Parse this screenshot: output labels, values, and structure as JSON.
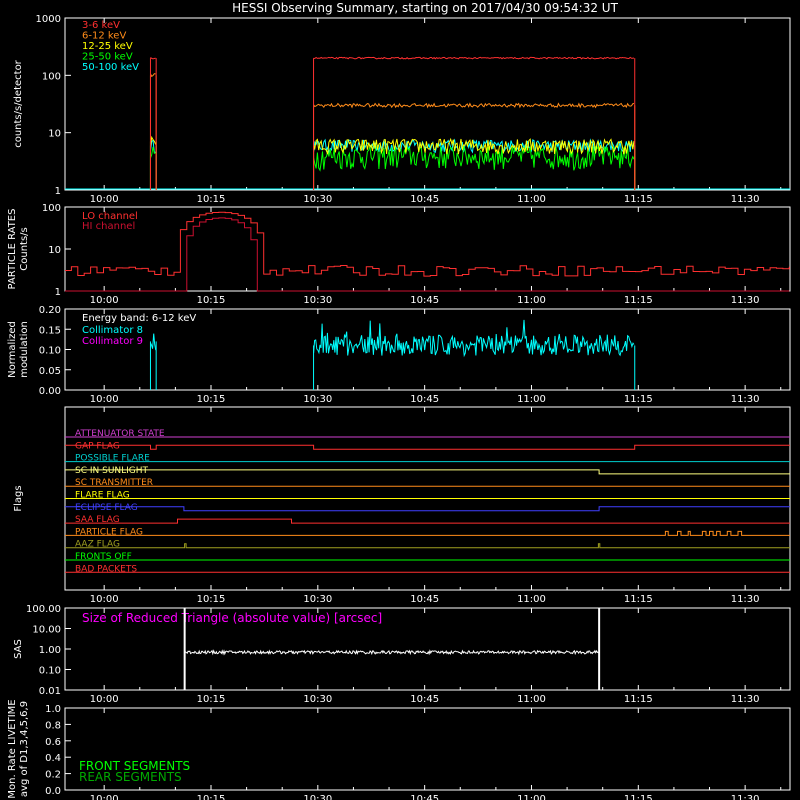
{
  "title": "HESSI Observing Summary, starting on 2017/04/30 09:54:32 UT",
  "time_axis": {
    "ticks": [
      "10:00",
      "10:15",
      "10:30",
      "10:45",
      "11:00",
      "11:15",
      "11:30"
    ],
    "tick_minutes": [
      0,
      15,
      30,
      45,
      60,
      75,
      90
    ],
    "range_minutes": [
      -5.5,
      96.3
    ]
  },
  "colors": {
    "axes": "#ffffff",
    "band_3_6": "#ff3030",
    "band_6_12": "#ff8c1a",
    "band_12_25": "#ffff00",
    "band_25_50": "#00ff00",
    "band_50_100": "#00ffff",
    "particle_lo": "#ff3030",
    "particle_hi": "#cc1030",
    "collimator_8": "#00ffff",
    "collimator_9": "#ff00ff",
    "sas": "#ffffff",
    "front_segments": "#00ff00",
    "rear_segments": "#00aa00"
  },
  "chart_data": [
    {
      "type": "line",
      "panel": "count-rates",
      "ylabel": "counts/s/detector",
      "yscale": "log",
      "ylim": [
        1,
        1000
      ],
      "yticks": [
        "1",
        "10",
        "100",
        "1000"
      ],
      "series": [
        {
          "name": "3-6 keV",
          "segments": [
            {
              "x": [
                6.5,
                7.3
              ],
              "level": 200
            },
            {
              "x": [
                29.4,
                74.5
              ],
              "level": 200
            }
          ]
        },
        {
          "name": "6-12 keV",
          "segments": [
            {
              "x": [
                6.5,
                7.3
              ],
              "level": 100
            },
            {
              "x": [
                29.4,
                74.5
              ],
              "level": 30
            }
          ]
        },
        {
          "name": "12-25 keV",
          "segments": [
            {
              "x": [
                6.5,
                7.3
              ],
              "level": 7
            },
            {
              "x": [
                29.4,
                74.5
              ],
              "level": 6
            }
          ]
        },
        {
          "name": "25-50 keV",
          "segments": [
            {
              "x": [
                6.5,
                7.3
              ],
              "level": 4
            },
            {
              "x": [
                29.4,
                74.5
              ],
              "level": 4
            }
          ]
        },
        {
          "name": "50-100 keV",
          "segments": [
            {
              "x": [
                6.5,
                7.3
              ],
              "level": 6
            },
            {
              "x": [
                29.4,
                74.5
              ],
              "level": 6
            }
          ]
        }
      ]
    },
    {
      "type": "line",
      "panel": "particle-rates",
      "ylabel": "PARTICLE RATES Counts/s",
      "yscale": "log",
      "ylim": [
        1,
        100
      ],
      "yticks": [
        "1",
        "10",
        "100"
      ],
      "series": [
        {
          "name": "LO channel",
          "background": 3,
          "peak": 75,
          "peak_start": 10,
          "peak_end": 22
        },
        {
          "name": "HI channel",
          "background": 1,
          "peak": 55,
          "peak_start": 11,
          "peak_end": 21
        }
      ]
    },
    {
      "type": "line",
      "panel": "modulation",
      "ylabel": "Normalized modulation",
      "ylim": [
        0,
        0.2
      ],
      "yticks": [
        "0.00",
        "0.05",
        "0.10",
        "0.15",
        "0.20"
      ],
      "annotation": "Energy band: 6-12 keV",
      "series": [
        {
          "name": "Collimator 8",
          "segments": [
            {
              "x": [
                6.5,
                7.3
              ],
              "level": 0.12
            },
            {
              "x": [
                29.4,
                74.5
              ],
              "level": 0.11
            }
          ]
        },
        {
          "name": "Collimator 9",
          "segments": []
        }
      ]
    },
    {
      "type": "table",
      "panel": "flags",
      "ylabel": "Flags",
      "rows": [
        {
          "label": "ATTENUATOR STATE",
          "color": "#d040d0",
          "changes": [],
          "initial": 0
        },
        {
          "label": "GAP FLAG",
          "color": "#ff3030",
          "changes": [
            6.5,
            7.3,
            29.4,
            74.5
          ],
          "initial": 1
        },
        {
          "label": "POSSIBLE FLARE",
          "color": "#00d0d0",
          "changes": [],
          "initial": 0
        },
        {
          "label": "SC IN SUNLIGHT",
          "color": "#ffff80",
          "changes": [
            69.5
          ],
          "initial": 1
        },
        {
          "label": "SC TRANSMITTER",
          "color": "#ff8c1a",
          "changes": [],
          "initial": 0
        },
        {
          "label": "FLARE FLAG",
          "color": "#ffff00",
          "changes": [],
          "initial": 0
        },
        {
          "label": "ECLIPSE FLAG",
          "color": "#4040ff",
          "changes": [
            11.2,
            69.5
          ],
          "initial": 1
        },
        {
          "label": "SAA FLAG",
          "color": "#ff3030",
          "changes": [
            10.3,
            26.3
          ],
          "initial": 0
        },
        {
          "label": "PARTICLE FLAG",
          "color": "#ff8c1a",
          "changes": [
            78.8,
            79.2,
            80.5,
            81,
            82,
            82.3,
            84,
            84.5,
            85,
            85.5,
            86,
            86.5,
            87.5,
            88,
            89,
            89.5
          ],
          "initial": 0
        },
        {
          "label": "AAZ FLAG",
          "color": "#a0a020",
          "changes": [
            11.3,
            11.5,
            69.4,
            69.6
          ],
          "initial": 0
        },
        {
          "label": "FRONTS OFF",
          "color": "#00ff00",
          "changes": [],
          "initial": 0
        },
        {
          "label": "BAD PACKETS",
          "color": "#ff3030",
          "changes": [],
          "initial": 0
        }
      ]
    },
    {
      "type": "line",
      "panel": "sas",
      "ylabel": "SAS",
      "yscale": "log",
      "ylim": [
        0.01,
        100
      ],
      "yticks": [
        "0.01",
        "0.10",
        "1.00",
        "10.00",
        "100.00"
      ],
      "annotation": "Size of Reduced Triangle (absolute value) [arcsec]",
      "series": [
        {
          "segments": [
            {
              "x": [
                11.3,
                69.5
              ],
              "level": 0.7
            }
          ]
        }
      ]
    },
    {
      "type": "line",
      "panel": "livetime",
      "ylabel": "Mon. Rate LIVETIME avg of D1,3,4,5,6,9",
      "ylim": [
        0,
        1
      ],
      "yticks": [
        "0.0",
        "0.2",
        "0.4",
        "0.6",
        "0.8",
        "1.0"
      ],
      "series": [
        {
          "name": "FRONT SEGMENTS",
          "segments": []
        },
        {
          "name": "REAR SEGMENTS",
          "segments": []
        }
      ]
    }
  ]
}
